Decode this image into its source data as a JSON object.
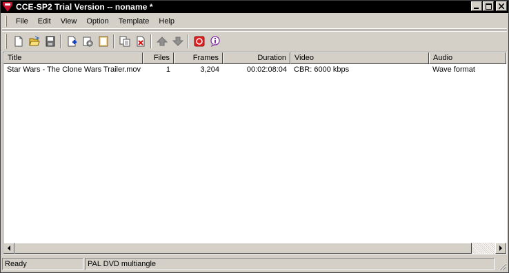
{
  "window": {
    "title": "CCE-SP2 Trial Version -- noname *"
  },
  "menu": [
    "File",
    "Edit",
    "View",
    "Option",
    "Template",
    "Help"
  ],
  "toolbar": {
    "buttons": [
      "new-icon",
      "open-icon",
      "save-icon",
      "add-icon",
      "settings-icon",
      "notepad-icon",
      "copy-icon",
      "delete-icon",
      "move-up-icon",
      "move-down-icon",
      "record-icon",
      "info-icon"
    ]
  },
  "list": {
    "columns": [
      "Title",
      "Files",
      "Frames",
      "Duration",
      "Video",
      "Audio"
    ],
    "rows": [
      {
        "title": "Star Wars - The Clone Wars Trailer.mov",
        "files": "1",
        "frames": "3,204",
        "duration": "00:02:08:04",
        "video": "CBR: 6000 kbps",
        "audio": "Wave format"
      }
    ]
  },
  "status": {
    "left": "Ready",
    "right": "PAL DVD multiangle"
  },
  "colors": {
    "titlebar": "#000000",
    "face": "#d4d0c8",
    "record": "#e02020"
  }
}
